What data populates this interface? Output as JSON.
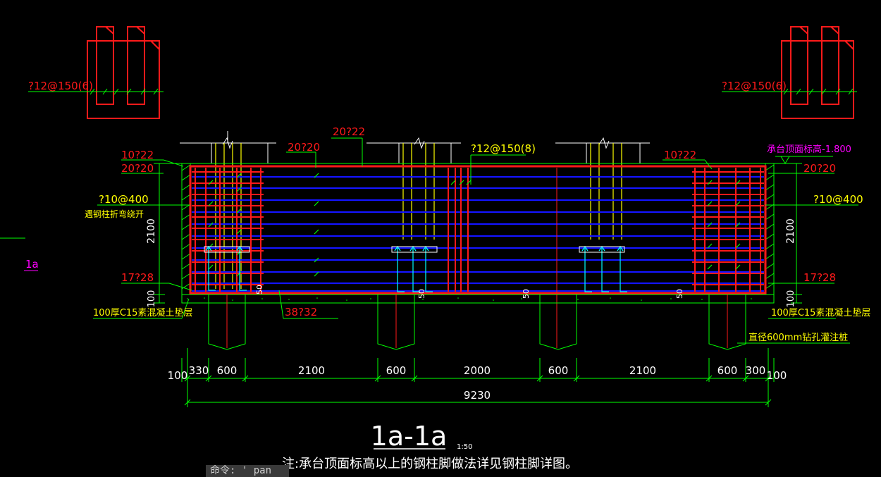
{
  "colors": {
    "background": "#000000",
    "red": "#ff1a1a",
    "green": "#00ff00",
    "blue": "#0000ff",
    "cyan": "#00ffff",
    "yellow": "#ffff00",
    "white": "#ffffff",
    "magenta": "#ff00ff"
  },
  "stirrup_labels": {
    "left": "?12@150(6)",
    "right": "?12@150(6)"
  },
  "rebar_labels": {
    "top_center": "20?22",
    "top_left_mid": "20?20",
    "top_middle": "?12@150(8)",
    "left_top1": "10?22",
    "left_top2": "20?20",
    "left_side": "?10@400",
    "left_note": "遇钢柱折弯绕开",
    "left_bottom": "17?28",
    "bottom_mid": "38?32",
    "right_top1": "10?22",
    "right_top2": "20?20",
    "right_side": "?10@400",
    "right_bottom": "17?28"
  },
  "elevation_label": "承台顶面标高-1.800",
  "height_dims": {
    "left_total": "2100",
    "left_pad": "100",
    "right_total": "2100",
    "right_pad": "100"
  },
  "pad_labels": {
    "left": "100厚C15素混凝土垫层",
    "right": "100厚C15素混凝土垫层"
  },
  "pile_label": "直径600mm钻孔灌注桩",
  "small_dims": [
    "50",
    "50",
    "50",
    "50"
  ],
  "section_marker": "1a",
  "bottom_dims": [
    "100",
    "330",
    "600",
    "2100",
    "600",
    "2000",
    "600",
    "2100",
    "600",
    "300",
    "100"
  ],
  "total_dim": "9230",
  "title": {
    "main": "1a-1a",
    "scale": "1:50"
  },
  "note": "注:承台顶面标高以上的钢柱脚做法详见钢柱脚详图。",
  "command_line": "命令: ' pan"
}
